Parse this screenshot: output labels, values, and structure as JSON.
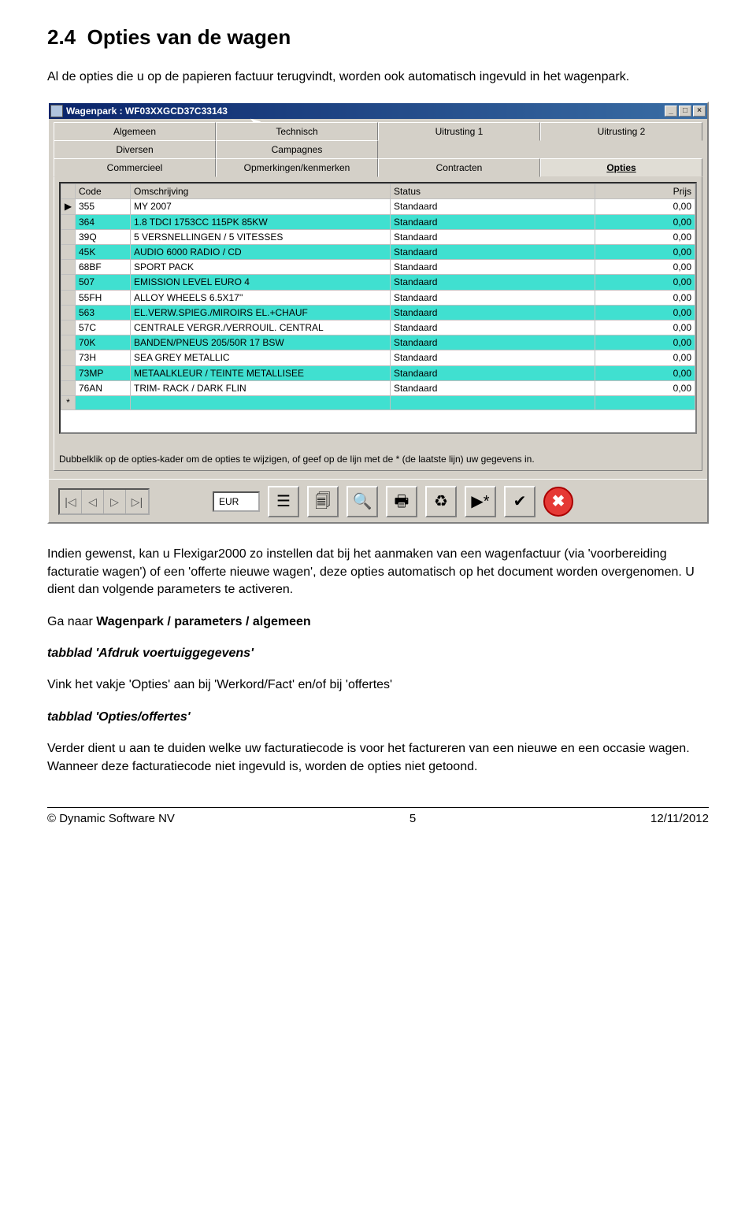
{
  "doc": {
    "section_number": "2.4",
    "section_title": "Opties van de wagen",
    "intro": "Al de opties die u op de papieren factuur terugvindt, worden ook automatisch ingevuld in het wagenpark."
  },
  "window": {
    "title": "Wagenpark : WF03XXGCD37C33143",
    "controls": {
      "min": "_",
      "max": "□",
      "close": "×"
    },
    "tabs_row1": [
      "Algemeen",
      "Technisch",
      "Uitrusting 1",
      "Uitrusting 2"
    ],
    "tabs_row2": [
      "Diversen",
      "Campagnes"
    ],
    "tabs_row3": [
      "Commercieel",
      "Opmerkingen/kenmerken",
      "Contracten",
      "Opties"
    ],
    "active_tab": "Opties",
    "grid": {
      "headers": {
        "code": "Code",
        "desc": "Omschrijving",
        "status": "Status",
        "price": "Prijs"
      },
      "rows": [
        {
          "code": "355",
          "desc": "MY 2007",
          "status": "Standaard",
          "price": "0,00"
        },
        {
          "code": "364",
          "desc": "1.8 TDCI 1753CC 115PK 85KW",
          "status": "Standaard",
          "price": "0,00"
        },
        {
          "code": "39Q",
          "desc": "5 VERSNELLINGEN / 5 VITESSES",
          "status": "Standaard",
          "price": "0,00"
        },
        {
          "code": "45K",
          "desc": "AUDIO 6000 RADIO / CD",
          "status": "Standaard",
          "price": "0,00"
        },
        {
          "code": "68BF",
          "desc": "SPORT PACK",
          "status": "Standaard",
          "price": "0,00"
        },
        {
          "code": "507",
          "desc": "EMISSION LEVEL EURO 4",
          "status": "Standaard",
          "price": "0,00"
        },
        {
          "code": "55FH",
          "desc": "ALLOY WHEELS 6.5X17''",
          "status": "Standaard",
          "price": "0,00"
        },
        {
          "code": "563",
          "desc": "EL.VERW.SPIEG./MIROIRS EL.+CHAUF",
          "status": "Standaard",
          "price": "0,00"
        },
        {
          "code": "57C",
          "desc": "CENTRALE VERGR./VERROUIL. CENTRAL",
          "status": "Standaard",
          "price": "0,00"
        },
        {
          "code": "70K",
          "desc": "BANDEN/PNEUS 205/50R 17 BSW",
          "status": "Standaard",
          "price": "0,00"
        },
        {
          "code": "73H",
          "desc": "SEA GREY METALLIC",
          "status": "Standaard",
          "price": "0,00"
        },
        {
          "code": "73MP",
          "desc": "METAALKLEUR / TEINTE METALLISEE",
          "status": "Standaard",
          "price": "0,00"
        },
        {
          "code": "76AN",
          "desc": "TRIM- RACK / DARK FLIN",
          "status": "Standaard",
          "price": "0,00"
        }
      ],
      "row_marker": "▶",
      "new_marker": "*",
      "hint": "Dubbelklik op de opties-kader om de opties te wijzigen, of geef op de lijn met de * (de laatste lijn) uw gegevens in."
    },
    "toolbar": {
      "currency": "EUR"
    }
  },
  "body": {
    "p1": "Indien gewenst, kan u Flexigar2000 zo instellen dat bij het aanmaken van een wagenfactuur (via 'voorbereiding facturatie wagen') of een 'offerte nieuwe wagen', deze opties automatisch op het document worden overgenomen. U dient dan volgende parameters te activeren.",
    "p2a": "Ga naar ",
    "p2b": "Wagenpark / parameters / algemeen",
    "h1": "tabblad 'Afdruk voertuiggegevens'",
    "p3": "Vink het vakje 'Opties' aan bij 'Werkord/Fact' en/of bij 'offertes'",
    "h2": "tabblad 'Opties/offertes'",
    "p4": "Verder dient u aan te duiden welke uw facturatiecode is voor het factureren van een nieuwe en een occasie wagen. Wanneer deze facturatiecode niet ingevuld is, worden de opties niet getoond."
  },
  "footer": {
    "left": "© Dynamic Software NV",
    "center": "5",
    "right": "12/11/2012"
  }
}
